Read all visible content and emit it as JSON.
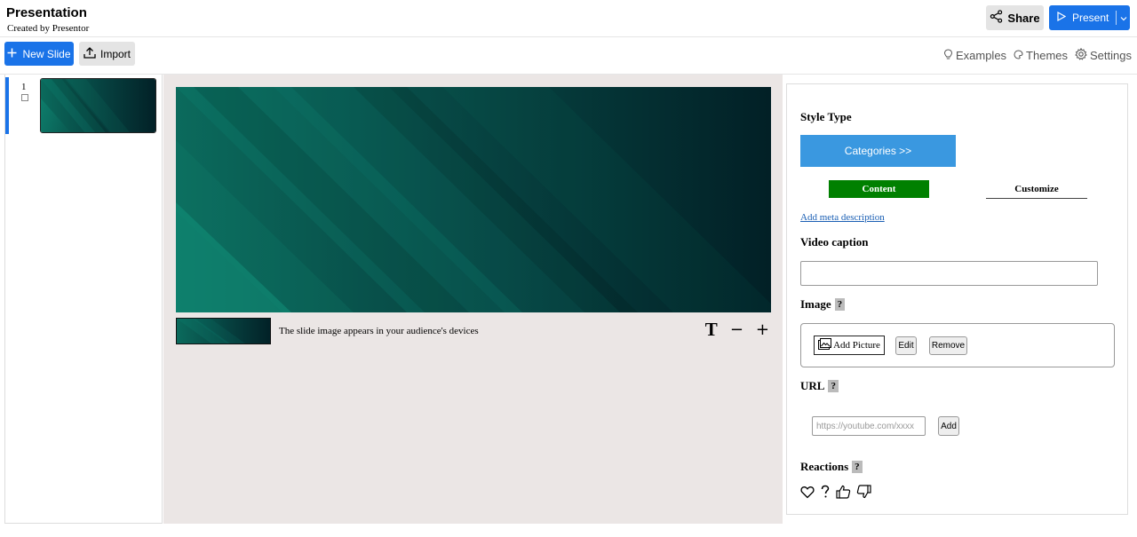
{
  "header": {
    "title": "Presentation",
    "subtitle": "Created by Presentor",
    "share_label": "Share",
    "present_label": "Present"
  },
  "toolbar": {
    "new_slide_label": "New Slide",
    "import_label": "Import",
    "links": [
      {
        "label": "Examples",
        "icon": "lightbulb-icon"
      },
      {
        "label": "Themes",
        "icon": "palette-icon"
      },
      {
        "label": "Settings",
        "icon": "gear-icon"
      }
    ]
  },
  "slides": [
    {
      "number": "1",
      "selected": true
    }
  ],
  "editor": {
    "notes_text": "The slide image appears in your audience's devices",
    "tools": {
      "text": "T",
      "minus": "−",
      "plus": "+"
    }
  },
  "panel": {
    "style_type_label": "Style Type",
    "categories_label": "Categories >>",
    "tabs": [
      {
        "label": "Content",
        "active": true
      },
      {
        "label": "Customize",
        "active": false
      }
    ],
    "meta_link": "Add meta description",
    "video_caption_label": "Video caption",
    "video_caption_value": "",
    "image_label": "Image",
    "help_mark": "?",
    "add_picture_label": "Add Picture",
    "edit_label": "Edit",
    "remove_label": "Remove",
    "url_label": "URL",
    "url_placeholder": "https://youtube.com/xxxx",
    "add_label": "Add",
    "reactions_label": "Reactions",
    "reaction_icons": [
      "heart-icon",
      "question-icon",
      "thumbs-up-icon",
      "thumbs-down-icon"
    ]
  },
  "colors": {
    "primary": "#1a73e8",
    "categories": "#3a98e0",
    "content_tab": "#008000",
    "canvas_bg": "#ebe6e5",
    "slide_dark": "#022026",
    "slide_teal": "#0b6e61"
  }
}
